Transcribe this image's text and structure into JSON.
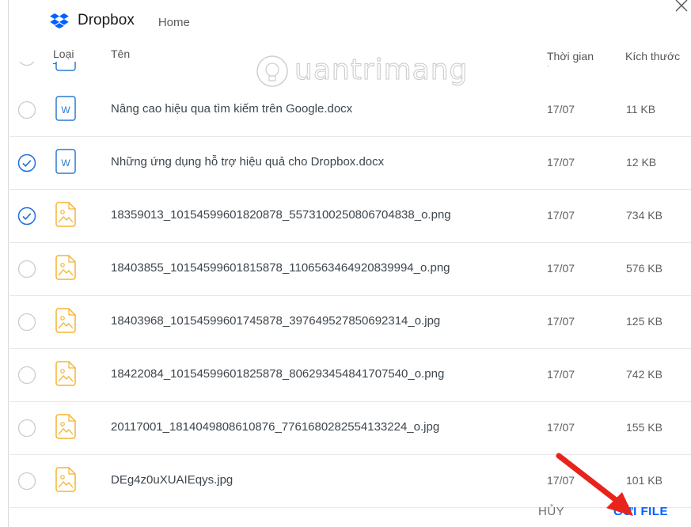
{
  "header": {
    "brand": "Dropbox",
    "breadcrumb": "Home"
  },
  "columns": {
    "type": "Loại",
    "name": "Tên",
    "time": "Thời gian",
    "size": "Kích thước"
  },
  "files": [
    {
      "name": "Nâng cao hiệu qua tìm kiếm trên Google.docx",
      "date": "17/07",
      "size": "11 KB",
      "kind": "word",
      "selected": false
    },
    {
      "name": "Những ứng dụng hỗ trợ hiệu quả cho Dropbox.docx",
      "date": "17/07",
      "size": "12 KB",
      "kind": "word",
      "selected": true
    },
    {
      "name": "18359013_10154599601820878_5573100250806704838_o.png",
      "date": "17/07",
      "size": "734 KB",
      "kind": "image",
      "selected": true
    },
    {
      "name": "18403855_10154599601815878_1106563464920839994_o.png",
      "date": "17/07",
      "size": "576 KB",
      "kind": "image",
      "selected": false
    },
    {
      "name": "18403968_10154599601745878_397649527850692314_o.jpg",
      "date": "17/07",
      "size": "125 KB",
      "kind": "image",
      "selected": false
    },
    {
      "name": "18422084_10154599601825878_806293454841707540_o.png",
      "date": "17/07",
      "size": "742 KB",
      "kind": "image",
      "selected": false
    },
    {
      "name": "20117001_1814049808610876_7761680282554133224_o.jpg",
      "date": "17/07",
      "size": "155 KB",
      "kind": "image",
      "selected": false
    },
    {
      "name": "DEg4z0uXUAIEqys.jpg",
      "date": "17/07",
      "size": "101 KB",
      "kind": "image",
      "selected": false
    }
  ],
  "footer": {
    "cancel_label": "HỦY",
    "send_label": "GỬI FILE"
  },
  "watermark": "uantrimang",
  "colors": {
    "accent": "#0061fe",
    "check": "#1e6fd9",
    "word_icon": "#2b7cd3",
    "image_icon": "#f5b330",
    "arrow": "#e8231b"
  },
  "icons": {
    "logo": "dropbox-logo-icon",
    "close": "close-icon",
    "word": "word-document-icon",
    "image": "image-file-icon",
    "checked": "checked-circle-icon",
    "unchecked": "empty-circle-icon"
  }
}
